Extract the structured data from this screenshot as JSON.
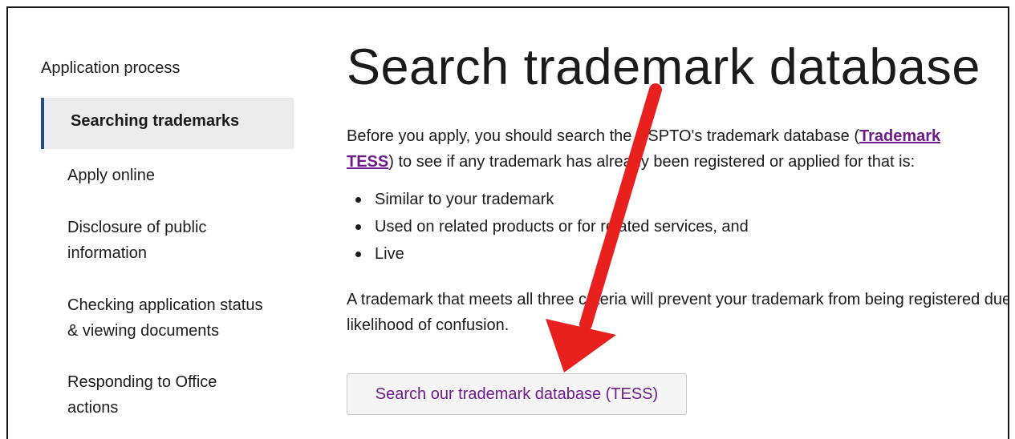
{
  "sidebar": {
    "heading": "Application process",
    "active_item": "Searching trademarks",
    "items": [
      {
        "label_lines": [
          "Apply online"
        ]
      },
      {
        "label_lines": [
          "Disclosure of public",
          "information"
        ]
      },
      {
        "label_lines": [
          "Checking application status",
          "& viewing documents"
        ]
      },
      {
        "label_lines": [
          "Responding to Office",
          "actions"
        ]
      }
    ]
  },
  "main": {
    "title": "Search trademark database",
    "intro_line1_before": "Before you apply, you should search the USPTO's trademark database (",
    "intro_link_part1": "Trademark",
    "intro_link_part2": "TESS",
    "intro_line2_after": ") to see if any trademark has already been registered or applied for that is:",
    "criteria": [
      "Similar to your trademark",
      "Used on related products or for related services, and",
      "Live"
    ],
    "para2_line1": "A trademark that meets all three criteria will prevent your trademark from being registered due to a",
    "para2_line2": "likelihood of confusion.",
    "search_button": "Search our trademark database (TESS)"
  },
  "colors": {
    "annotation_arrow": "#e8201e",
    "link": "#6e1b8c",
    "active_nav_border": "#1f4e8c"
  }
}
